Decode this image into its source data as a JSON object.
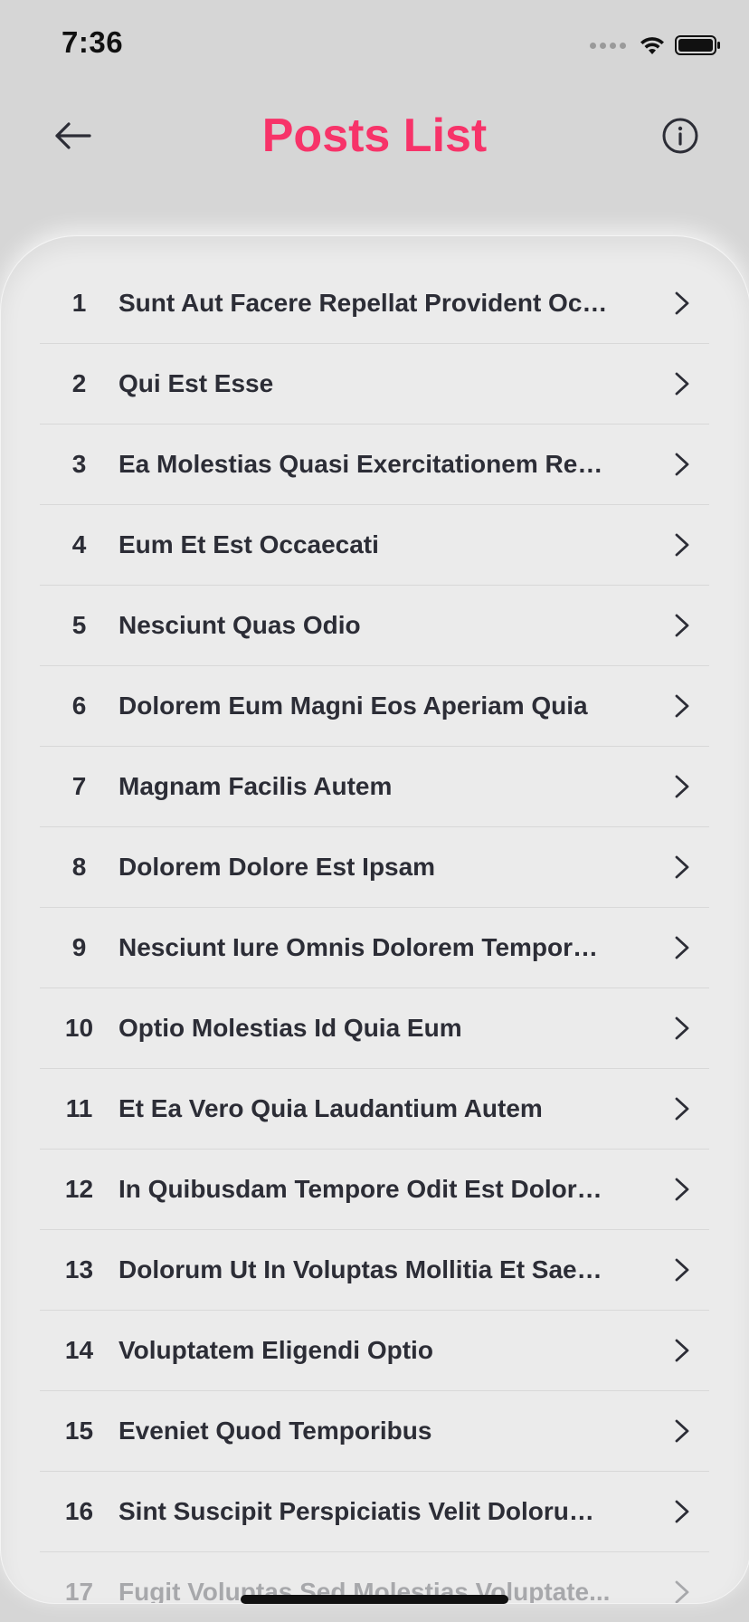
{
  "status_bar": {
    "time": "7:36"
  },
  "nav": {
    "title": "Posts List",
    "back_icon": "arrow-left-icon",
    "info_icon": "info-circle-icon"
  },
  "colors": {
    "accent": "#f73369",
    "background": "#d6d6d6",
    "sheet": "#ebebeb",
    "text": "#2c2d36"
  },
  "posts": [
    {
      "id": "1",
      "title": "Sunt Aut Facere Repellat Provident Occ..."
    },
    {
      "id": "2",
      "title": "Qui Est Esse"
    },
    {
      "id": "3",
      "title": "Ea Molestias Quasi Exercitationem Repe..."
    },
    {
      "id": "4",
      "title": "Eum Et Est Occaecati"
    },
    {
      "id": "5",
      "title": "Nesciunt Quas Odio"
    },
    {
      "id": "6",
      "title": "Dolorem Eum Magni Eos Aperiam Quia"
    },
    {
      "id": "7",
      "title": "Magnam Facilis Autem"
    },
    {
      "id": "8",
      "title": "Dolorem Dolore Est Ipsam"
    },
    {
      "id": "9",
      "title": "Nesciunt Iure Omnis Dolorem Tempora E..."
    },
    {
      "id": "10",
      "title": "Optio Molestias Id Quia Eum"
    },
    {
      "id": "11",
      "title": "Et Ea Vero Quia Laudantium Autem"
    },
    {
      "id": "12",
      "title": "In Quibusdam Tempore Odit Est Dolorem"
    },
    {
      "id": "13",
      "title": "Dolorum Ut In Voluptas Mollitia Et Saepe..."
    },
    {
      "id": "14",
      "title": "Voluptatem Eligendi Optio"
    },
    {
      "id": "15",
      "title": "Eveniet Quod Temporibus"
    },
    {
      "id": "16",
      "title": "Sint Suscipit Perspiciatis Velit Dolorum..."
    },
    {
      "id": "17",
      "title": "Fugit Voluptas Sed Molestias Voluptate..."
    }
  ]
}
